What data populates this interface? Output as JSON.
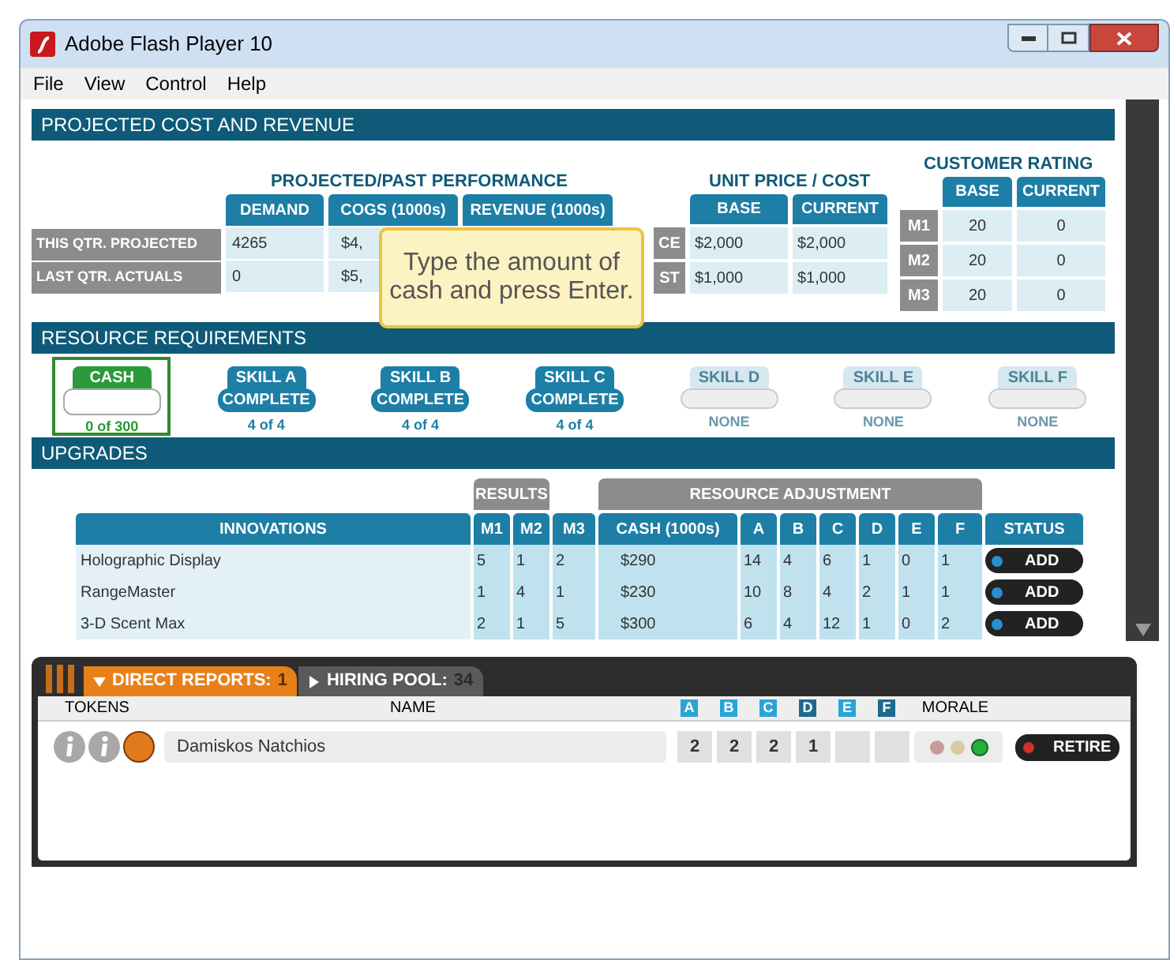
{
  "window": {
    "title": "Adobe Flash Player 10"
  },
  "menu": [
    "File",
    "View",
    "Control",
    "Help"
  ],
  "projected": {
    "title": "PROJECTED COST AND REVENUE",
    "performance": {
      "title": "PROJECTED/PAST PERFORMANCE",
      "columns": [
        "DEMAND",
        "COGS (1000s)",
        "REVENUE (1000s)"
      ],
      "rows": [
        {
          "label": "THIS QTR. PROJECTED",
          "cells": [
            "4265",
            "$4,"
          ]
        },
        {
          "label": "LAST QTR. ACTUALS",
          "cells": [
            "0",
            "$5,"
          ]
        }
      ]
    },
    "unit_price": {
      "title": "UNIT PRICE / COST",
      "columns": [
        "BASE",
        "CURRENT"
      ],
      "rows": [
        {
          "label": "CE",
          "cells": [
            "$2,000",
            "$2,000"
          ]
        },
        {
          "label": "ST",
          "cells": [
            "$1,000",
            "$1,000"
          ]
        }
      ]
    },
    "customer_rating": {
      "title": "CUSTOMER RATING",
      "columns": [
        "BASE",
        "CURRENT"
      ],
      "rows": [
        {
          "label": "M1",
          "cells": [
            "20",
            "0"
          ]
        },
        {
          "label": "M2",
          "cells": [
            "20",
            "0"
          ]
        },
        {
          "label": "M3",
          "cells": [
            "20",
            "0"
          ]
        }
      ]
    },
    "tooltip": "Type the amount of cash and press Enter."
  },
  "resources": {
    "title": "RESOURCE REQUIREMENTS",
    "items": [
      {
        "kind": "cash",
        "label": "CASH",
        "progress": "0 of 300",
        "selected": true
      },
      {
        "kind": "skill",
        "label": "SKILL A",
        "status": "COMPLETE",
        "progress": "4 of 4",
        "disabled": false
      },
      {
        "kind": "skill",
        "label": "SKILL B",
        "status": "COMPLETE",
        "progress": "4 of 4",
        "disabled": false
      },
      {
        "kind": "skill",
        "label": "SKILL C",
        "status": "COMPLETE",
        "progress": "4 of 4",
        "disabled": false
      },
      {
        "kind": "skill",
        "label": "SKILL D",
        "progress": "NONE",
        "disabled": true
      },
      {
        "kind": "skill",
        "label": "SKILL E",
        "progress": "NONE",
        "disabled": true
      },
      {
        "kind": "skill",
        "label": "SKILL F",
        "progress": "NONE",
        "disabled": true
      }
    ]
  },
  "upgrades": {
    "title": "UPGRADES",
    "groups": [
      "RESULTS",
      "RESOURCE ADJUSTMENT"
    ],
    "columns": [
      "INNOVATIONS",
      "M1",
      "M2",
      "M3",
      "CASH (1000s)",
      "A",
      "B",
      "C",
      "D",
      "E",
      "F",
      "STATUS"
    ],
    "rows": [
      {
        "cells": [
          "Holographic Display",
          "5",
          "1",
          "2",
          "$290",
          "14",
          "4",
          "6",
          "1",
          "0",
          "1"
        ],
        "action": "ADD"
      },
      {
        "cells": [
          "RangeMaster",
          "1",
          "4",
          "1",
          "$230",
          "10",
          "8",
          "4",
          "2",
          "1",
          "1"
        ],
        "action": "ADD"
      },
      {
        "cells": [
          "3-D Scent Max",
          "2",
          "1",
          "5",
          "$300",
          "6",
          "4",
          "12",
          "1",
          "0",
          "2"
        ],
        "action": "ADD"
      }
    ]
  },
  "reports": {
    "tabs": [
      {
        "label": "DIRECT REPORTS:",
        "count": "1",
        "selected": true
      },
      {
        "label": "HIRING POOL:",
        "count": "34",
        "selected": false
      }
    ],
    "columns": [
      "TOKENS",
      "NAME",
      "A",
      "B",
      "C",
      "D",
      "E",
      "F",
      "MORALE"
    ],
    "rows": [
      {
        "name": "Damiskos Natchios",
        "skills": [
          "2",
          "2",
          "2",
          "1"
        ],
        "morale": [
          {
            "color": "#c99a9a",
            "lit": false
          },
          {
            "color": "#d8c9a0",
            "lit": false
          },
          {
            "color": "#22b03a",
            "lit": true
          }
        ],
        "action": "RETIRE"
      }
    ]
  }
}
